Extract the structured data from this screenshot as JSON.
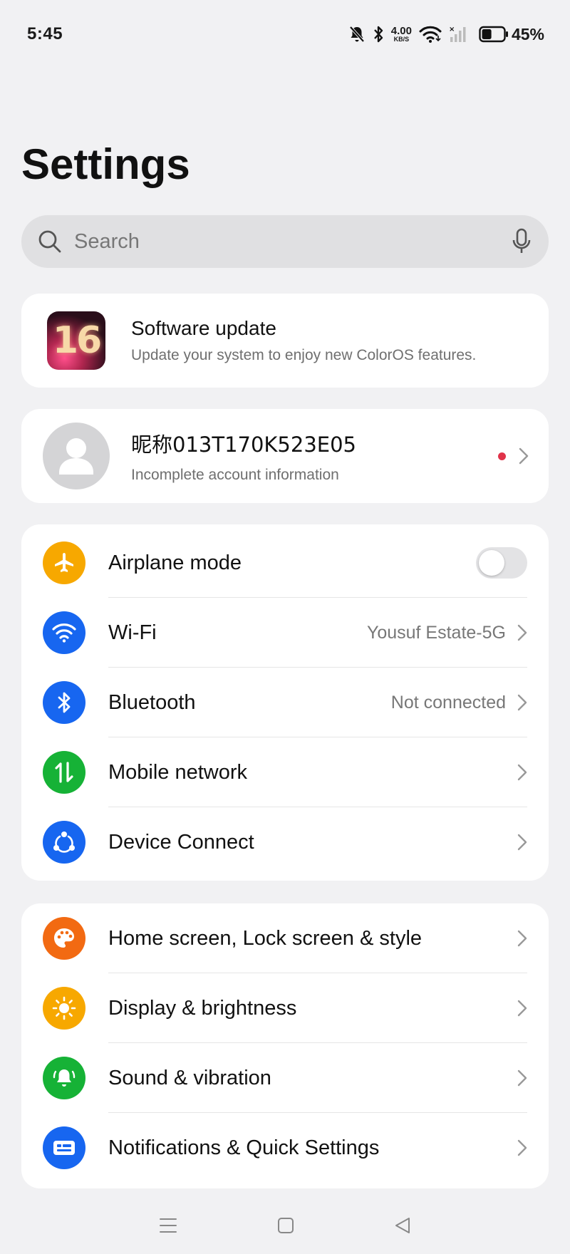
{
  "status_bar": {
    "time": "5:45",
    "net_speed_value": "4.00",
    "net_speed_unit": "KB/S",
    "battery_percent": "45%",
    "battery_level": 0.45
  },
  "page": {
    "title": "Settings"
  },
  "search": {
    "placeholder": "Search"
  },
  "software_update": {
    "logo_text": "16",
    "title": "Software update",
    "subtitle": "Update your system to enjoy new ColorOS features."
  },
  "account": {
    "name": "昵称013T170K523E05",
    "subtitle": "Incomplete account information"
  },
  "connectivity": [
    {
      "label": "Airplane mode",
      "value": "",
      "icon": "airplane-icon",
      "color": "#F7A800",
      "toggle": false
    },
    {
      "label": "Wi-Fi",
      "value": "Yousuf Estate-5G",
      "icon": "wifi-icon",
      "color": "#1766F0"
    },
    {
      "label": "Bluetooth",
      "value": "Not connected",
      "icon": "bluetooth-icon",
      "color": "#1766F0"
    },
    {
      "label": "Mobile network",
      "value": "",
      "icon": "mobile-data-icon",
      "color": "#16B236"
    },
    {
      "label": "Device Connect",
      "value": "",
      "icon": "device-connect-icon",
      "color": "#1766F0"
    }
  ],
  "personalization": [
    {
      "label": "Home screen, Lock screen & style",
      "icon": "palette-icon",
      "color": "#F26A12"
    },
    {
      "label": "Display & brightness",
      "icon": "sun-icon",
      "color": "#F7A800"
    },
    {
      "label": "Sound & vibration",
      "icon": "bell-icon",
      "color": "#16B236"
    },
    {
      "label": "Notifications & Quick Settings",
      "icon": "notification-icon",
      "color": "#1766F0"
    }
  ]
}
